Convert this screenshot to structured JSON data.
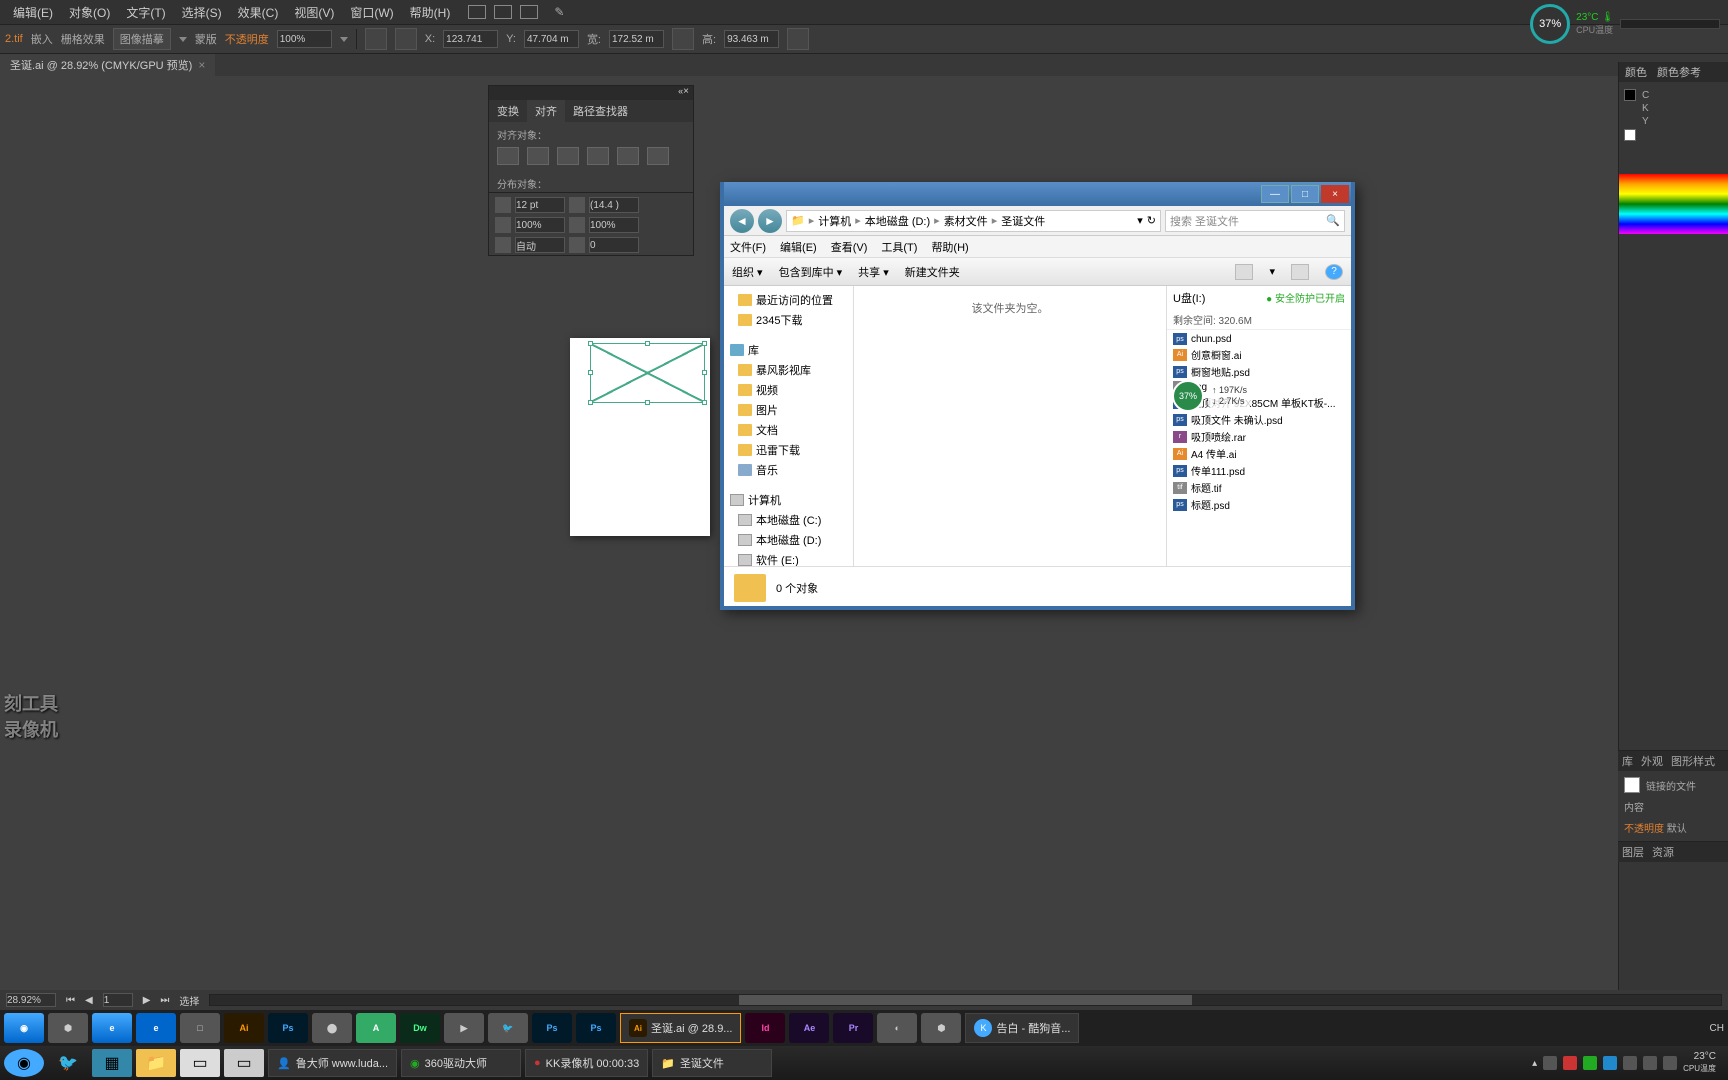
{
  "menubar": {
    "items": [
      "编辑(E)",
      "对象(O)",
      "文字(T)",
      "选择(S)",
      "效果(C)",
      "视图(V)",
      "窗口(W)",
      "帮助(H)"
    ]
  },
  "optbar": {
    "tool_label": "2.tif",
    "embed": "嵌入",
    "crop": "栅格效果",
    "imgtrace": "图像描摹",
    "mask": "蒙版",
    "opacity_label": "不透明度",
    "opacity_value": "100%",
    "x_label": "X:",
    "x_value": "123.741",
    "y_label": "Y:",
    "y_value": "47.704 m",
    "w_label": "宽:",
    "w_value": "172.52 m",
    "h_label": "高:",
    "h_value": "93.463 m"
  },
  "tab": {
    "title": "圣诞.ai @ 28.92% (CMYK/GPU 预览)"
  },
  "panel_align": {
    "tabs": [
      "变换",
      "对齐",
      "路径查找器"
    ],
    "sec1": "对齐对象：",
    "sec2": "分布对象："
  },
  "panel_char": {
    "size": "12 pt",
    "lead": "(14.4 )",
    "track": "100%",
    "track2": "100%",
    "va": "自动",
    "kern": "0"
  },
  "right": {
    "tab1": "颜色",
    "tab2": "颜色参考",
    "c": "C",
    "k": "K",
    "y": "Y",
    "links_tab1": "库",
    "links_tab2": "外观",
    "links_tab3": "图形样式",
    "linked": "链接的文件",
    "content": "内容",
    "opacity_lbl": "不透明度",
    "opacity_val": "默认",
    "layers_tab1": "图层",
    "layers_tab2": "资源"
  },
  "statusbar": {
    "zoom": "28.92%",
    "artboard": "1",
    "tool": "选择"
  },
  "explorer": {
    "breadcrumb": [
      "计算机",
      "本地磁盘 (D:)",
      "素材文件",
      "圣诞文件"
    ],
    "search_placeholder": "搜索 圣诞文件",
    "menu": [
      "文件(F)",
      "编辑(E)",
      "查看(V)",
      "工具(T)",
      "帮助(H)"
    ],
    "toolbar": [
      "组织",
      "包含到库中",
      "共享",
      "新建文件夹"
    ],
    "sidebar": {
      "recent": "最近访问的位置",
      "dl2345": "2345下载",
      "lib": "库",
      "baofeng": "暴风影视库",
      "video": "视频",
      "pics": "图片",
      "docs": "文档",
      "xunlei": "迅雷下载",
      "music": "音乐",
      "computer": "计算机",
      "c": "本地磁盘 (C:)",
      "d": "本地磁盘 (D:)",
      "e": "软件 (E:)"
    },
    "empty_msg": "该文件夹为空。",
    "right": {
      "drive": "U盘(I:)",
      "safe": "安全防护已开启",
      "space": "剩余空间: 320.6M",
      "files": [
        {
          "ext": "psd",
          "name": "chun.psd"
        },
        {
          "ext": "ai",
          "name": "创意橱窗.ai"
        },
        {
          "ext": "psd",
          "name": "橱窗地贴.psd"
        },
        {
          "ext": "jpg",
          "name": ".jpg"
        },
        {
          "ext": "psd",
          "name": "吸顶对齐  92X85CM 单板KT板-..."
        },
        {
          "ext": "psd",
          "name": "吸顶文件 未确认.psd"
        },
        {
          "ext": "rar",
          "name": "吸顶喷绘.rar"
        },
        {
          "ext": "ai",
          "name": "A4 传单.ai"
        },
        {
          "ext": "psd",
          "name": "传单111.psd"
        },
        {
          "ext": "tif",
          "name": "标题.tif"
        },
        {
          "ext": "psd",
          "name": "标题.psd"
        }
      ]
    },
    "status": "0 个对象"
  },
  "cpu": {
    "pct": "37%",
    "temp": "23°C",
    "label": "CPU温度"
  },
  "net": {
    "pct": "37%",
    "up": "197K/s",
    "down": "2.7K/s"
  },
  "watermark": {
    "l1": "刻工具",
    "l2": "录像机"
  },
  "taskbar1": {
    "ai_task": "圣诞.ai @ 28.9...",
    "kugou": "告白 - 酷狗音..."
  },
  "taskbar2": {
    "luda": "鲁大师 www.luda...",
    "driver": "360驱动大师",
    "kk": "KK录像机 00:00:33",
    "folder": "圣诞文件",
    "temp": "23°C",
    "templbl": "CPU温度",
    "input": "CH"
  }
}
